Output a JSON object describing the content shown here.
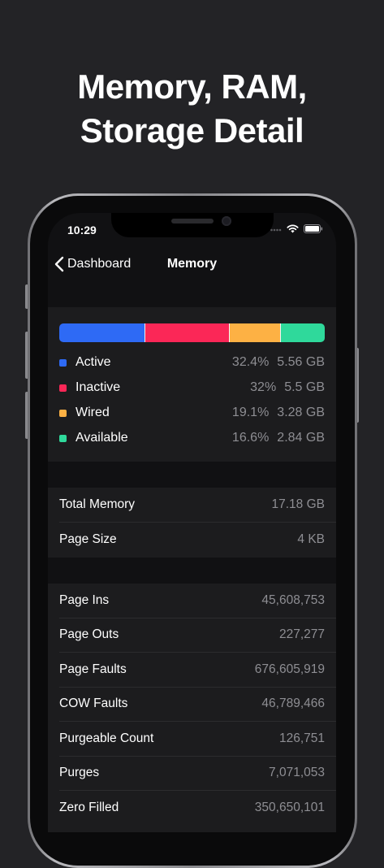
{
  "headline": "Memory, RAM,\nStorage Detail",
  "status_bar": {
    "time": "10:29"
  },
  "nav": {
    "back_label": "Dashboard",
    "title": "Memory"
  },
  "memory_breakdown": {
    "items": [
      {
        "label": "Active",
        "percent": "32.4%",
        "size": "5.56 GB",
        "fraction": 0.324,
        "color": "#2e6af5"
      },
      {
        "label": "Inactive",
        "percent": "32%",
        "size": "5.5 GB",
        "fraction": 0.32,
        "color": "#fb2757"
      },
      {
        "label": "Wired",
        "percent": "19.1%",
        "size": "3.28 GB",
        "fraction": 0.191,
        "color": "#fdb144"
      },
      {
        "label": "Available",
        "percent": "16.6%",
        "size": "2.84 GB",
        "fraction": 0.166,
        "color": "#2fd99b"
      }
    ]
  },
  "summary": [
    {
      "label": "Total Memory",
      "value": "17.18 GB"
    },
    {
      "label": "Page Size",
      "value": "4 KB"
    }
  ],
  "stats": [
    {
      "label": "Page Ins",
      "value": "45,608,753"
    },
    {
      "label": "Page Outs",
      "value": "227,277"
    },
    {
      "label": "Page Faults",
      "value": "676,605,919"
    },
    {
      "label": "COW Faults",
      "value": "46,789,466"
    },
    {
      "label": "Purgeable Count",
      "value": "126,751"
    },
    {
      "label": "Purges",
      "value": "7,071,053"
    },
    {
      "label": "Zero Filled",
      "value": "350,650,101"
    }
  ],
  "icons": {
    "back": "chevron-left-icon",
    "signal": "cellular-signal-icon",
    "wifi": "wifi-icon",
    "battery": "battery-icon"
  }
}
